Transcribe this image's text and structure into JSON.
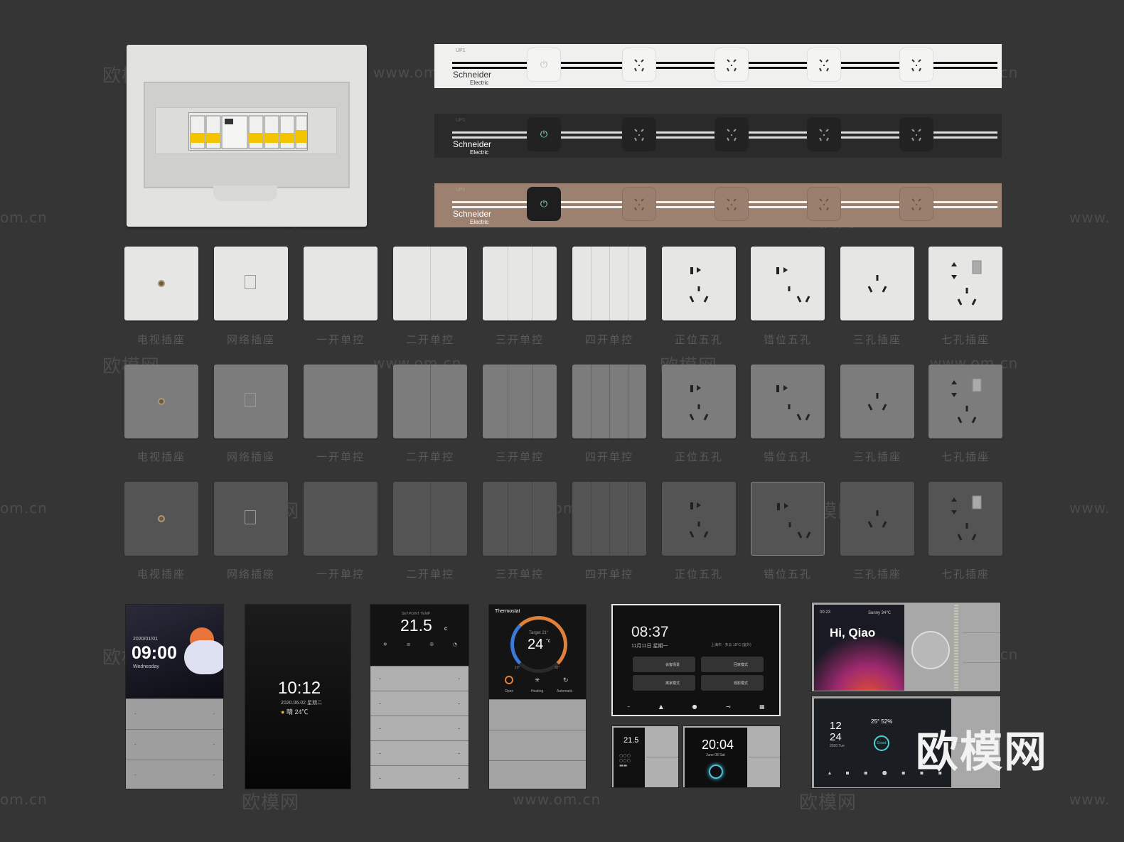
{
  "watermarks": {
    "brand_cn": "欧模网",
    "url": "www.om.cn",
    "url_left": "om.cn",
    "url_right": "www."
  },
  "strips": [
    {
      "brand": "Schneider",
      "sub": "Electric",
      "model": "UP1",
      "power_glyph": "⏻"
    },
    {
      "brand": "Schneider",
      "sub": "Electric",
      "model": "UP1",
      "power_glyph": "⏻"
    },
    {
      "brand": "Schneider",
      "sub": "Electric",
      "model": "UP1",
      "power_glyph": "⏻"
    }
  ],
  "panel_labels": [
    "电视插座",
    "网络插座",
    "一开单控",
    "二开单控",
    "三开单控",
    "四开单控",
    "正位五孔",
    "错位五孔",
    "三孔插座",
    "七孔插座"
  ],
  "smart_panels": {
    "p1": {
      "date": "2020/01/01",
      "time": "09:00",
      "weekday": "Wednesday"
    },
    "p2": {
      "time": "10:12",
      "date": "2020.06.02 星期二",
      "weather": "晴 24℃"
    },
    "p3": {
      "temp": "21.5",
      "unit": "c",
      "header": "SETPOINT TEMP"
    },
    "p4": {
      "title": "Thermostat",
      "target": "Target 21°",
      "temp": "24",
      "unit": "°c",
      "min": "10°",
      "max": "32°",
      "modes": [
        "Open",
        "Heating",
        "Automatic"
      ]
    },
    "p5": {
      "time": "08:37",
      "date": "11月11日 星期一",
      "info": "上海市 · 多云 18°C (室外)",
      "tiles": [
        "会客场景",
        "回家模式",
        "离家模式",
        "观影模式"
      ]
    },
    "p6": {
      "time": "00:23",
      "weather": "Sunny 34℃",
      "greeting": "Hi, Qiao"
    },
    "p7": {
      "month": "12",
      "day": "24",
      "temp": "25° 52%",
      "badge": "Good",
      "sub": "2020 Tue"
    },
    "p8": {
      "temp": "21.5"
    },
    "p9": {
      "time": "20:04",
      "date": "June 08 Sat"
    }
  }
}
